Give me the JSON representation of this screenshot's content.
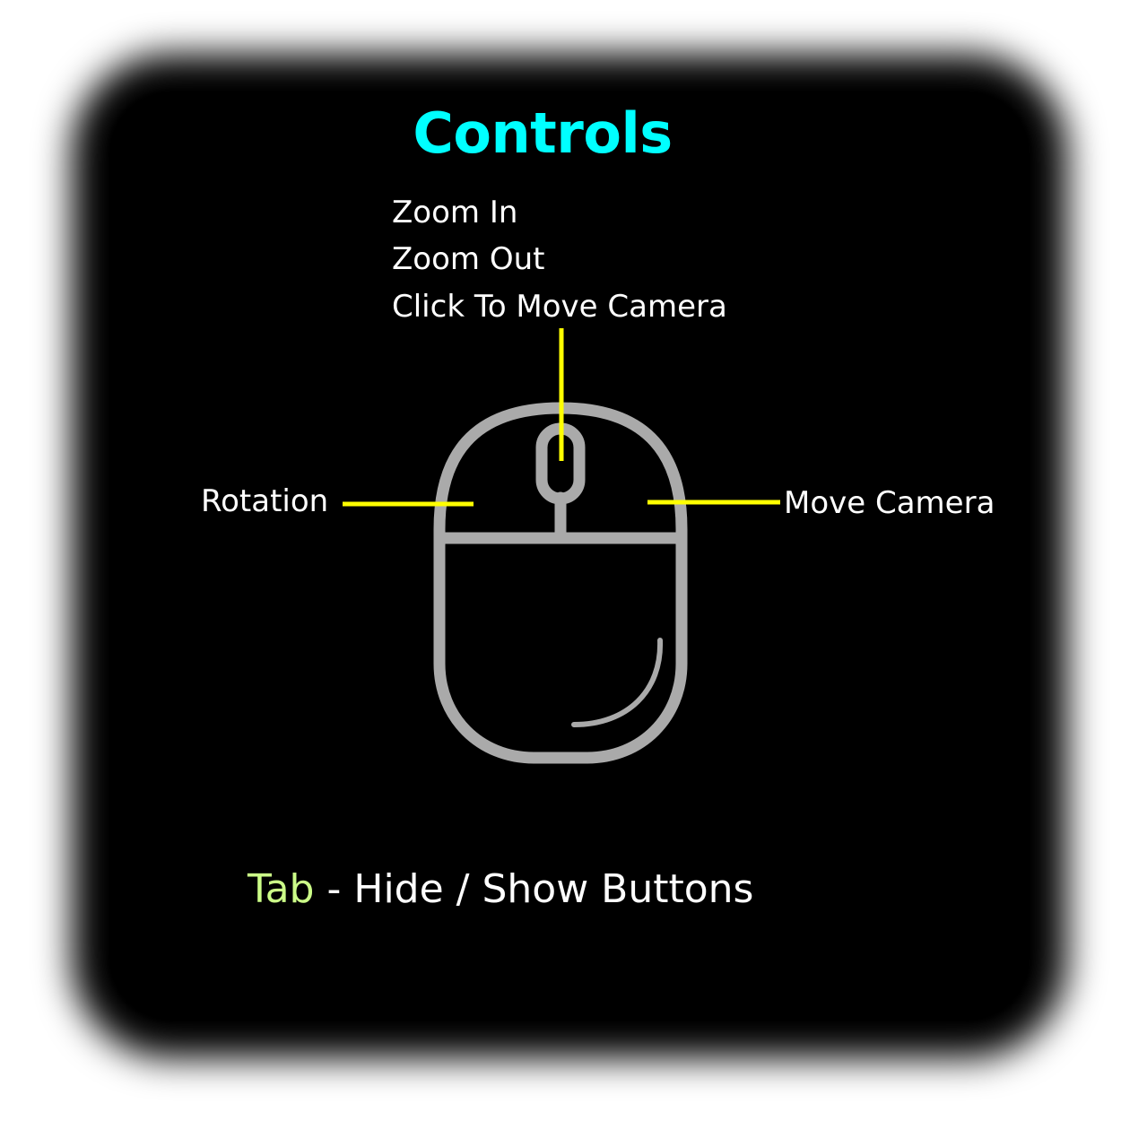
{
  "title": "Controls",
  "mouse_labels": {
    "wheel_up": "Zoom In",
    "wheel_down": "Zoom Out",
    "wheel_click": "Click To Move Camera",
    "left_button": "Rotation",
    "right_button": "Move Camera"
  },
  "keyboard_hint": {
    "key": "Tab",
    "separator": " - ",
    "action": "Hide / Show Buttons"
  },
  "colors": {
    "title": "#00ffff",
    "key": "#ccff88",
    "text": "#ffffff",
    "leader_lines": "#ffff00",
    "mouse_outline": "#aaaaaa",
    "panel": "#000000"
  },
  "icons": [
    "mouse-icon"
  ]
}
